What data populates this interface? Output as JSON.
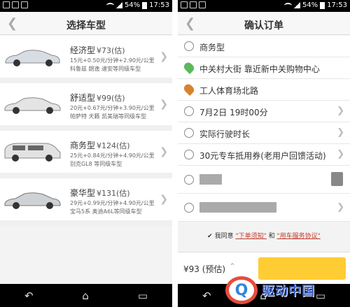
{
  "status": {
    "battery": "54%",
    "time": "17:53"
  },
  "left": {
    "title": "选择车型",
    "cars": [
      {
        "name": "经济型",
        "price": "¥73(估)",
        "line1": "15元+0.50元/分钟+2.90元/公里",
        "line2": "科鲁兹 朗逸 速安等同级车型"
      },
      {
        "name": "舒适型",
        "price": "¥99(估)",
        "line1": "20元+0.67元/分钟+3.90元/公里",
        "line2": "帕萨特 天籁 凯美瑞等同级车型"
      },
      {
        "name": "商务型",
        "price": "¥124(估)",
        "line1": "25元+0.84元/分钟+4.90元/公里",
        "line2": "别克GL8 等同级车型"
      },
      {
        "name": "豪华型",
        "price": "¥131(估)",
        "line1": "29元+0.99元/分钟+4.90元/公里",
        "line2": "宝马5系 奥迪A6L等同级车型"
      }
    ]
  },
  "right": {
    "title": "确认订单",
    "car_type": "商务型",
    "pickup": "中关村大街 靠近新中关购物中心",
    "destination": "工人体育场北路",
    "time": "7月2日 19时00分",
    "duration": "实际行驶时长",
    "coupon": "30元专车抵用券(老用户回馈活动)",
    "agree_prefix": "我同意",
    "agree_link1": "\"下单须知\"",
    "agree_and": "和",
    "agree_link2": "\"用车服务协议\"",
    "fee": "¥93 (预估)"
  },
  "watermark": {
    "text": "驱动中国",
    "letter": "Q"
  },
  "colors": {
    "accent": "#ffcc33",
    "pickup_pin": "#5cb85c",
    "dest_pin": "#d9822b",
    "link": "#c0392b"
  }
}
